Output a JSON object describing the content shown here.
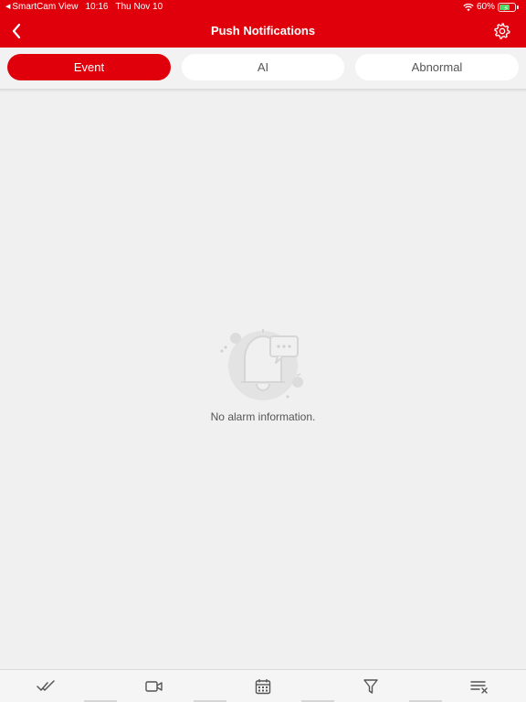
{
  "status_bar": {
    "back_app": "SmartCam View",
    "time": "10:16",
    "date": "Thu Nov 10",
    "battery": "60%"
  },
  "header": {
    "title": "Push Notifications",
    "back_icon": "chevron-left-icon",
    "settings_icon": "gear-icon"
  },
  "tabs": [
    {
      "label": "Event",
      "active": true
    },
    {
      "label": "AI",
      "active": false
    },
    {
      "label": "Abnormal",
      "active": false
    }
  ],
  "empty_state": {
    "icon": "bell-empty-icon",
    "message": "No alarm information."
  },
  "toolbar": {
    "items": [
      {
        "icon": "double-check-icon"
      },
      {
        "icon": "video-camera-icon"
      },
      {
        "icon": "calendar-icon"
      },
      {
        "icon": "filter-icon"
      },
      {
        "icon": "clear-list-icon"
      }
    ]
  },
  "colors": {
    "brand": "#e0000b",
    "background": "#f0f0f0",
    "battery": "#4cd964"
  }
}
